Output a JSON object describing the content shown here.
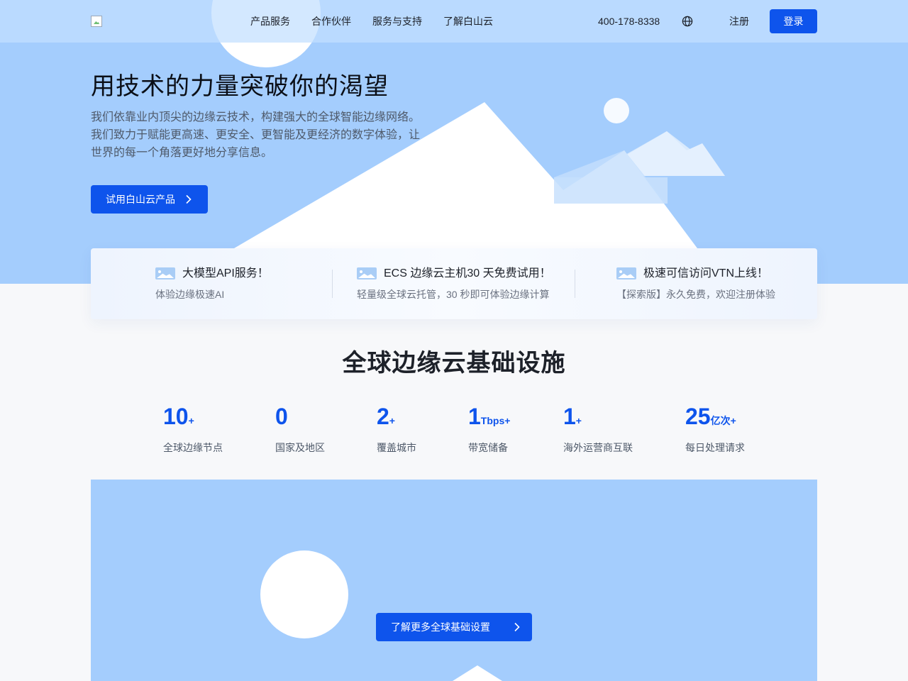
{
  "nav": {
    "links": [
      "产品服务",
      "合作伙伴",
      "服务与支持",
      "了解白山云"
    ],
    "phone": "400-178-8338",
    "register": "注册",
    "login": "登录"
  },
  "hero": {
    "title": "用技术的力量突破你的渴望",
    "description": "我们依靠业内顶尖的边缘云技术，构建强大的全球智能边缘网络。我们致力于赋能更高速、更安全、更智能及更经济的数字体验，让世界的每一个角落更好地分享信息。",
    "cta": "试用白山云产品"
  },
  "announcements": [
    {
      "title": "大模型API服务！",
      "subtitle": "体验边缘极速AI"
    },
    {
      "title": "ECS 边缘云主机30 天免费试用！",
      "subtitle": "轻量级全球云托管，30 秒即可体验边缘计算"
    },
    {
      "title": "极速可信访问VTN上线！",
      "subtitle": "【探索版】永久免费，欢迎注册体验"
    }
  ],
  "infrastructure": {
    "title": "全球边缘云基础设施",
    "stats": [
      {
        "value": "10",
        "unit": "+",
        "label": "全球边缘节点"
      },
      {
        "value": "0",
        "unit": "",
        "label": "国家及地区"
      },
      {
        "value": "2",
        "unit": "+",
        "label": "覆盖城市"
      },
      {
        "value": "1",
        "unit": "Tbps+",
        "label": "带宽储备"
      },
      {
        "value": "1",
        "unit": "+",
        "label": "海外运营商互联"
      },
      {
        "value": "25",
        "unit": "亿次+",
        "label": "每日处理请求"
      }
    ],
    "more_button": "了解更多全球基础设置"
  },
  "icons": {
    "globe": "globe-icon",
    "chevron": "chevron-right-icon",
    "announcement_image": "image-placeholder-icon"
  },
  "colors": {
    "accent": "#0e54ec",
    "hero_bg": "#a4cdfd",
    "page_bg": "#f7f8fa"
  }
}
